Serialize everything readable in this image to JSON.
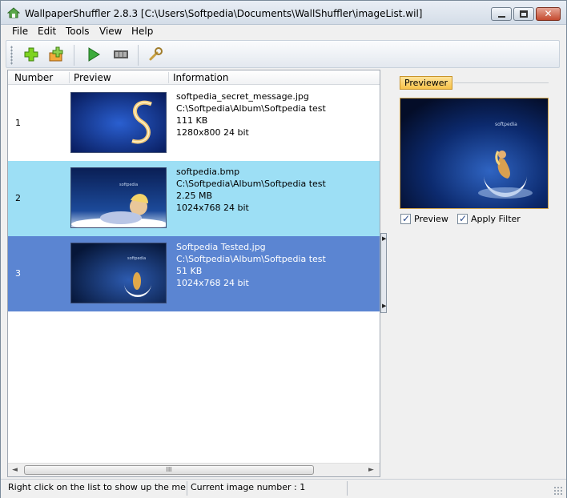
{
  "window": {
    "title": "WallpaperShuffler 2.8.3 [C:\\Users\\Softpedia\\Documents\\WallShuffler\\imageList.wil]",
    "close_glyph": "✕"
  },
  "menu": {
    "items": [
      "File",
      "Edit",
      "Tools",
      "View",
      "Help"
    ]
  },
  "toolbar": {
    "buttons": [
      {
        "icon": "add-icon"
      },
      {
        "icon": "add-folder-icon"
      },
      {
        "icon": "play-icon"
      },
      {
        "icon": "filmstrip-icon"
      },
      {
        "icon": "wrench-icon"
      }
    ]
  },
  "list": {
    "columns": [
      "Number",
      "Preview",
      "Information"
    ],
    "rows": [
      {
        "number": "1",
        "filename": "softpedia_secret_message.jpg",
        "path": "C:\\Softpedia\\Album\\Softpedia test",
        "size": "111 KB",
        "dimensions": "1280x800 24 bit",
        "state": "normal"
      },
      {
        "number": "2",
        "filename": "softpedia.bmp",
        "path": "C:\\Softpedia\\Album\\Softpedia test",
        "size": "2.25 MB",
        "dimensions": "1024x768 24 bit",
        "state": "highlight"
      },
      {
        "number": "3",
        "filename": "Softpedia Tested.jpg",
        "path": "C:\\Softpedia\\Album\\Softpedia test",
        "size": "51 KB",
        "dimensions": "1024x768 24 bit",
        "state": "selected"
      }
    ],
    "scroll_left": "◄",
    "scroll_right": "►",
    "scroll_grip": "III"
  },
  "splitter": {
    "arrow_up": "▶",
    "arrow_down": "▶"
  },
  "previewer": {
    "tab_label": "Previewer",
    "preview_checkbox": "Preview",
    "preview_checked": true,
    "filter_checkbox": "Apply Filter",
    "filter_checked": true
  },
  "status": {
    "hint": "Right click on the list to show up the menu",
    "current": "Current image number : 1"
  },
  "colors": {
    "highlight_row": "#9ddff5",
    "selected_row": "#5b85d2",
    "previewer_tab": "#f7c24a"
  }
}
